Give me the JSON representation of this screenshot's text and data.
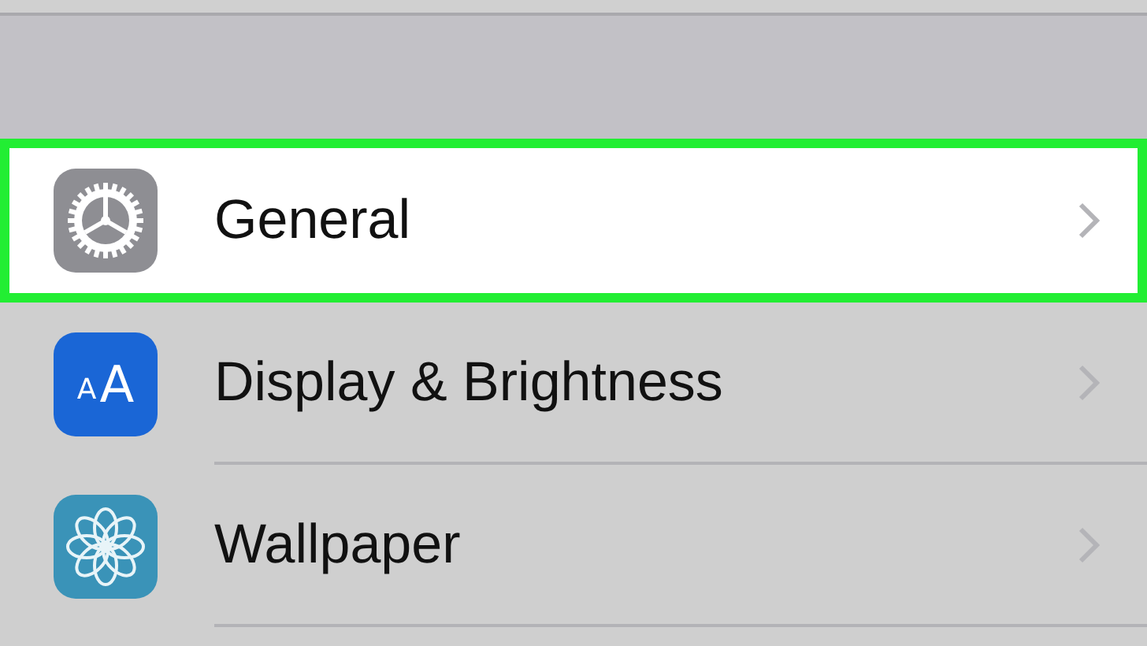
{
  "settings": {
    "items": [
      {
        "label": "General",
        "kind": "gear",
        "highlighted": true
      },
      {
        "label": "Display & Brightness",
        "kind": "letters",
        "icon_letters": [
          "A",
          "A"
        ],
        "highlighted": false
      },
      {
        "label": "Wallpaper",
        "kind": "flower",
        "highlighted": false
      }
    ]
  }
}
